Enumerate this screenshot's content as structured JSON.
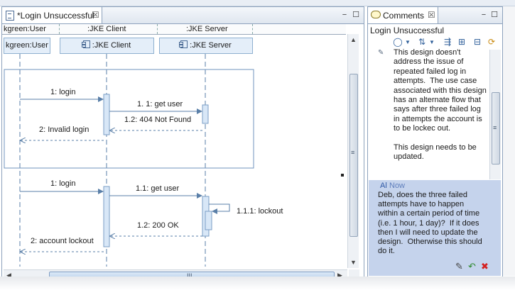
{
  "editor": {
    "tab_label": "*Login Unsuccessful",
    "tab_close": "☒",
    "minimize": "−",
    "maximize": "☐",
    "lane_headers": [
      "kgreen:User",
      ":JKE Client",
      ":JKE Server"
    ],
    "lifelines": [
      "kgreen:User",
      ":JKE Client",
      ":JKE Server"
    ],
    "messages": {
      "m1": "1: login",
      "m2": "1. 1: get user",
      "m3": "1.2: 404 Not Found",
      "m4": "2: Invalid login",
      "m5": "1: login",
      "m6": "1.1: get user",
      "m7": "1.1.1: lockout",
      "m8": "1.2: 200 OK",
      "m9": "2: account lockout"
    },
    "h_grip": "III",
    "v_grip": "≡"
  },
  "comments": {
    "tab_label": "Comments",
    "tab_close": "☒",
    "minimize": "−",
    "maximize": "☐",
    "title": "Login Unsuccessful",
    "toolbar_icons": [
      "speech-bubble-icon",
      "dropdown-icon",
      "sort-icon",
      "dropdown-icon",
      "filter-icon",
      "expand-all-icon",
      "collapse-all-icon",
      "sync-icon"
    ],
    "comment_text": "This design doesn't\naddress the issue of\nrepeated failed log in\nattempts.  The use case\nassociated with this design\nhas an alternate flow that\nsays after three failed log\nin attempts the account is\nto be lockec out.\n\nThis design needs to be\nupdated.",
    "reply_author": "Al",
    "reply_time": "Now",
    "reply_text": "Deb, does the three failed\nattempts have to happen\nwithin a certain period of time\n(i.e. 1 hour, 1 day)?  If it does\nthen I will need to update the\ndesign.  Otherwise this should\ndo it.",
    "v_grip": "≡"
  },
  "colors": {
    "accent": "#2e58a6",
    "reply_background": "#c5d3ec",
    "lifeline_box": "#e4eef9",
    "delete_red": "#d42020"
  }
}
